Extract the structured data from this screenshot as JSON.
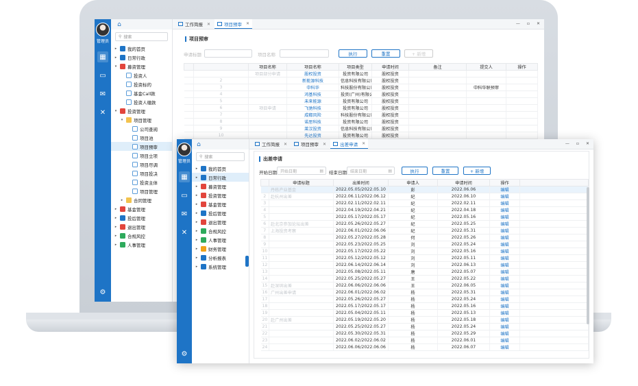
{
  "back": {
    "admin_label": "管理员",
    "search_placeholder": "搜索",
    "tabs": [
      {
        "label": "工作简报",
        "active": false
      },
      {
        "label": "项目预审",
        "active": true
      }
    ],
    "window_controls": [
      "—",
      "▫",
      "✕"
    ],
    "nav": [
      {
        "label": "我的首页",
        "level": 0,
        "caret": "▸",
        "icon_color": "#1e74c6"
      },
      {
        "label": "日常行政",
        "level": 0,
        "caret": "▸",
        "icon_color": "#1e74c6"
      },
      {
        "label": "募资管理",
        "level": 0,
        "caret": "▾",
        "icon_color": "#e2453c"
      },
      {
        "label": "投资人",
        "level": 1,
        "caret": "",
        "icon_color": "doc"
      },
      {
        "label": "投资标的",
        "level": 1,
        "caret": "",
        "icon_color": "doc"
      },
      {
        "label": "基金Call款",
        "level": 1,
        "caret": "",
        "icon_color": "doc"
      },
      {
        "label": "投资人缴款",
        "level": 1,
        "caret": "",
        "icon_color": "doc"
      },
      {
        "label": "投资管理",
        "level": 0,
        "caret": "▾",
        "icon_color": "#e2453c"
      },
      {
        "label": "项目管理",
        "level": 1,
        "caret": "▾",
        "icon_color": "folder"
      },
      {
        "label": "公司查阅",
        "level": 2,
        "caret": "",
        "icon_color": "doc"
      },
      {
        "label": "项目池",
        "level": 2,
        "caret": "",
        "icon_color": "doc"
      },
      {
        "label": "项目预审",
        "level": 2,
        "caret": "",
        "icon_color": "doc",
        "selected": true
      },
      {
        "label": "项目立项",
        "level": 2,
        "caret": "",
        "icon_color": "doc"
      },
      {
        "label": "项目尽调",
        "level": 2,
        "caret": "",
        "icon_color": "doc"
      },
      {
        "label": "项目投决",
        "level": 2,
        "caret": "",
        "icon_color": "doc"
      },
      {
        "label": "投资主体",
        "level": 2,
        "caret": "",
        "icon_color": "doc"
      },
      {
        "label": "项目管理",
        "level": 2,
        "caret": "",
        "icon_color": "doc"
      },
      {
        "label": "合同管理",
        "level": 1,
        "caret": "▸",
        "icon_color": "folder"
      },
      {
        "label": "基金管理",
        "level": 0,
        "caret": "▸",
        "icon_color": "#e2453c"
      },
      {
        "label": "投后管理",
        "level": 0,
        "caret": "▸",
        "icon_color": "#1e74c6"
      },
      {
        "label": "退出管理",
        "level": 0,
        "caret": "▸",
        "icon_color": "#e2453c"
      },
      {
        "label": "合规风控",
        "level": 0,
        "caret": "▸",
        "icon_color": "#2eaa5c"
      },
      {
        "label": "人事管理",
        "level": 0,
        "caret": "▸",
        "icon_color": "#2eaa5c"
      }
    ],
    "panel_title": "项目预审",
    "filter_labels": [
      "申请标题",
      "项目名称"
    ],
    "buttons": [
      "执行",
      "重置",
      "+ 新增"
    ],
    "columns": [
      "",
      "项目名称",
      "项目名称",
      "项目类型",
      "申请时间",
      "备注",
      "提交人",
      "操作"
    ],
    "rows": [
      {
        "n": "",
        "a": "项目部分申请",
        "b": "股权投资",
        "c": "投资有限公司",
        "d": "股权投资",
        "e": "",
        "f": "",
        "g": "",
        "op": "编辑"
      },
      {
        "n": "2",
        "a": "",
        "b": "新能源科技",
        "c": "信息科技有限公司",
        "d": "股权投资",
        "e": "",
        "f": "",
        "g": "",
        "op": "编辑"
      },
      {
        "n": "3",
        "a": "",
        "b": "中科华",
        "c": "科技股份有限公司",
        "d": "股权投资",
        "e": "",
        "f": "中科华联预审",
        "g": "",
        "op": "编辑"
      },
      {
        "n": "4",
        "a": "",
        "b": "鸿基科技",
        "c": "投资(广州)有限公司",
        "d": "股权投资",
        "e": "",
        "f": "",
        "g": "",
        "op": "编辑"
      },
      {
        "n": "5",
        "a": "",
        "b": "未来能源",
        "c": "投资有限公司",
        "d": "股权投资",
        "e": "",
        "f": "",
        "g": "",
        "op": "编辑"
      },
      {
        "n": "6",
        "a": "项目申请",
        "b": "飞驰科技",
        "c": "投资有限公司",
        "d": "股权投资",
        "e": "",
        "f": "",
        "g": "",
        "op": "编辑"
      },
      {
        "n": "7",
        "a": "",
        "b": "成都风险",
        "c": "科技股份有限公司",
        "d": "股权投资",
        "e": "",
        "f": "",
        "g": "",
        "op": "编辑"
      },
      {
        "n": "8",
        "a": "",
        "b": "诺思科技",
        "c": "投资有限公司",
        "d": "股权投资",
        "e": "",
        "f": "",
        "g": "",
        "op": "编辑"
      },
      {
        "n": "9",
        "a": "",
        "b": "莱汉投资",
        "c": "信息科技有限公司",
        "d": "股权投资",
        "e": "",
        "f": "",
        "g": "",
        "op": "编辑"
      },
      {
        "n": "10",
        "a": "",
        "b": "先达投资",
        "c": "投资有限公司",
        "d": "股权投资",
        "e": "",
        "f": "",
        "g": "",
        "op": "编辑"
      }
    ]
  },
  "front": {
    "admin_label": "管理员",
    "search_placeholder": "搜索",
    "tabs": [
      {
        "label": "工作简报",
        "active": false
      },
      {
        "label": "项目预审",
        "active": false
      },
      {
        "label": "出差申请",
        "active": true
      }
    ],
    "window_controls": [
      "—",
      "▫",
      "✕"
    ],
    "nav": [
      {
        "label": "我的首页",
        "icon_color": "#1e74c6"
      },
      {
        "label": "日常行政",
        "icon_color": "#1e74c6",
        "selected": true
      },
      {
        "label": "募资管理",
        "icon_color": "#e2453c"
      },
      {
        "label": "投资管理",
        "icon_color": "#e2453c"
      },
      {
        "label": "基金管理",
        "icon_color": "#e2453c"
      },
      {
        "label": "投后管理",
        "icon_color": "#1e74c6"
      },
      {
        "label": "退出管理",
        "icon_color": "#e2453c"
      },
      {
        "label": "合规风控",
        "icon_color": "#2eaa5c"
      },
      {
        "label": "人事管理",
        "icon_color": "#2eaa5c"
      },
      {
        "label": "财务管理",
        "icon_color": "#f0a21a"
      },
      {
        "label": "分析报表",
        "icon_color": "#1e74c6"
      },
      {
        "label": "系统管理",
        "icon_color": "#1e74c6"
      }
    ],
    "panel_title": "出差申请",
    "start_date_label": "开始日期",
    "start_date_placeholder": "开始日期",
    "end_date_label": "结束日期",
    "end_date_placeholder": "结束日期",
    "buttons": [
      "执行",
      "重置",
      "+ 新增"
    ],
    "columns": [
      "",
      "申请标题",
      "出差时间",
      "申请人",
      "申请时间",
      "操作"
    ],
    "rows": [
      {
        "n": "",
        "title": "丹栋产业基金",
        "range": "2022.05.05/2022.05.10",
        "who": "彭",
        "date": "2022.06.06",
        "op": "编辑"
      },
      {
        "n": "2",
        "title": "赴杭州出差",
        "range": "2022.06.11/2022.06.12",
        "who": "纪",
        "date": "2022.06.10",
        "op": "编辑"
      },
      {
        "n": "3",
        "title": "",
        "range": "2022.02.11/2022.02.11",
        "who": "纪",
        "date": "2022.02.11",
        "op": "编辑"
      },
      {
        "n": "4",
        "title": "",
        "range": "2022.04.19/2022.04.21",
        "who": "纪",
        "date": "2022.04.18",
        "op": "编辑"
      },
      {
        "n": "5",
        "title": "",
        "range": "2022.05.17/2022.05.17",
        "who": "纪",
        "date": "2022.05.16",
        "op": "编辑"
      },
      {
        "n": "6",
        "title": "赴北京参加论坛出差",
        "range": "2022.05.26/2022.05.27",
        "who": "纪",
        "date": "2022.05.25",
        "op": "编辑"
      },
      {
        "n": "7",
        "title": "上海投资考察",
        "range": "2022.06.01/2022.06.06",
        "who": "纪",
        "date": "2022.05.31",
        "op": "编辑"
      },
      {
        "n": "8",
        "title": "",
        "range": "2022.05.27/2022.05.28",
        "who": "何",
        "date": "2022.05.26",
        "op": "编辑"
      },
      {
        "n": "9",
        "title": "",
        "range": "2022.05.23/2022.05.25",
        "who": "刘",
        "date": "2022.05.24",
        "op": "编辑"
      },
      {
        "n": "10",
        "title": "",
        "range": "2022.05.17/2022.05.22",
        "who": "刘",
        "date": "2022.05.16",
        "op": "编辑"
      },
      {
        "n": "11",
        "title": "",
        "range": "2022.05.12/2022.05.12",
        "who": "刘",
        "date": "2022.05.11",
        "op": "编辑"
      },
      {
        "n": "12",
        "title": "",
        "range": "2022.06.14/2022.06.14",
        "who": "刘",
        "date": "2022.06.13",
        "op": "编辑"
      },
      {
        "n": "13",
        "title": "",
        "range": "2022.05.08/2022.05.11",
        "who": "唐",
        "date": "2022.05.07",
        "op": "编辑"
      },
      {
        "n": "14",
        "title": "",
        "range": "2022.05.25/2022.05.27",
        "who": "王",
        "date": "2022.05.22",
        "op": "编辑"
      },
      {
        "n": "15",
        "title": "赴深圳出差",
        "range": "2022.06.06/2022.06.06",
        "who": "王",
        "date": "2022.06.05",
        "op": "编辑"
      },
      {
        "n": "16",
        "title": "广州出差申请",
        "range": "2022.06.01/2022.06.02",
        "who": "杨",
        "date": "2022.05.31",
        "op": "编辑"
      },
      {
        "n": "17",
        "title": "",
        "range": "2022.05.26/2022.05.27",
        "who": "杨",
        "date": "2022.05.24",
        "op": "编辑"
      },
      {
        "n": "18",
        "title": "",
        "range": "2022.05.17/2022.05.17",
        "who": "杨",
        "date": "2022.05.16",
        "op": "编辑"
      },
      {
        "n": "19",
        "title": "",
        "range": "2022.05.04/2022.05.11",
        "who": "杨",
        "date": "2022.05.13",
        "op": "编辑"
      },
      {
        "n": "20",
        "title": "赴广州出差",
        "range": "2022.05.19/2022.05.20",
        "who": "杨",
        "date": "2022.05.18",
        "op": "编辑"
      },
      {
        "n": "21",
        "title": "",
        "range": "2022.05.25/2022.05.27",
        "who": "杨",
        "date": "2022.05.24",
        "op": "编辑"
      },
      {
        "n": "22",
        "title": "",
        "range": "2022.05.30/2022.05.31",
        "who": "杨",
        "date": "2022.05.29",
        "op": "编辑"
      },
      {
        "n": "23",
        "title": "",
        "range": "2022.06.02/2022.06.02",
        "who": "杨",
        "date": "2022.06.01",
        "op": "编辑"
      },
      {
        "n": "24",
        "title": "",
        "range": "2022.06.06/2022.06.06",
        "who": "杨",
        "date": "2022.06.07",
        "op": "编辑"
      }
    ]
  },
  "colors": {
    "brand": "#1e74c6",
    "accent_red": "#e2453c",
    "accent_green": "#2eaa5c",
    "accent_orange": "#f0a21a"
  }
}
